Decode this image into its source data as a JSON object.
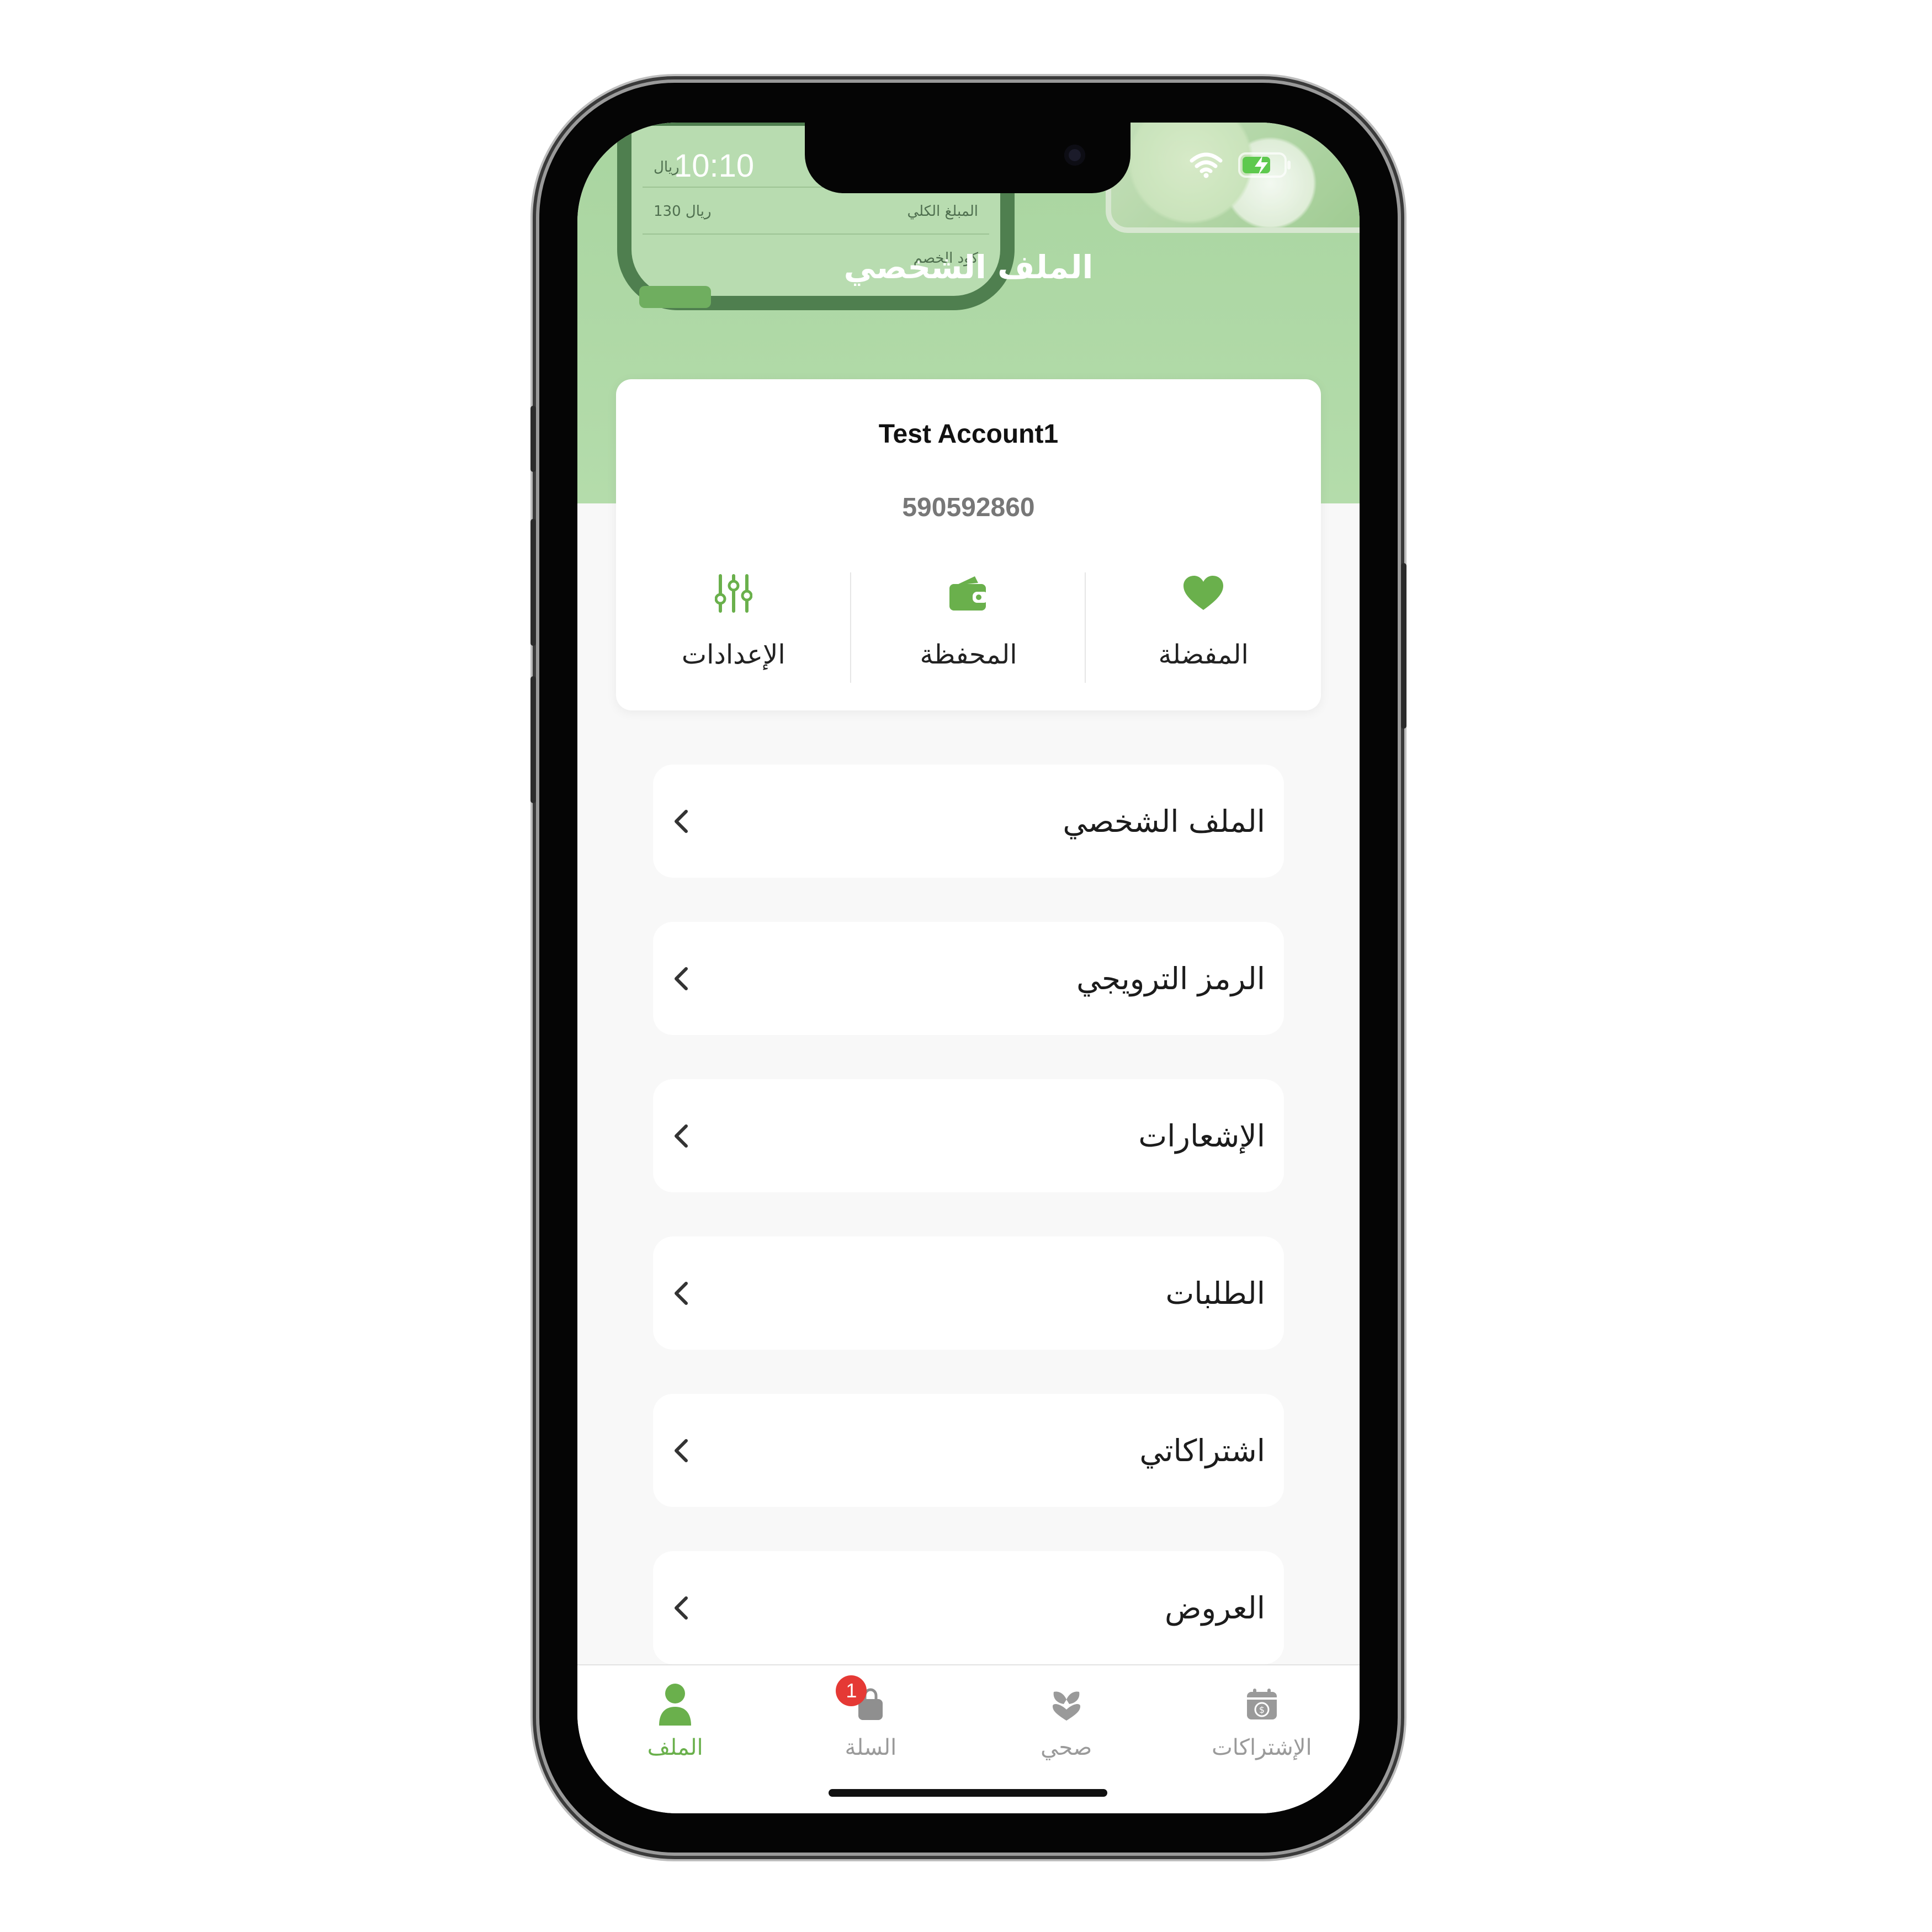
{
  "status_bar": {
    "time": "10:10"
  },
  "background_card": {
    "row1_left": "ريال",
    "row2_left": "130 ريال",
    "row2_right": "المبلغ الكلي",
    "row3_right": "كود الخصم"
  },
  "header": {
    "title": "الملف الشخصي"
  },
  "profile": {
    "name": "Test Account1",
    "phone": "590592860",
    "actions": [
      {
        "label": "المفضلة",
        "icon": "heart-icon"
      },
      {
        "label": "المحفظة",
        "icon": "wallet-icon"
      },
      {
        "label": "الإعدادات",
        "icon": "sliders-icon"
      }
    ]
  },
  "menu": {
    "items": [
      {
        "label": "الملف الشخصي"
      },
      {
        "label": "الرمز الترويجي"
      },
      {
        "label": "الإشعارات"
      },
      {
        "label": "الطلبات"
      },
      {
        "label": "اشتراكاتي"
      },
      {
        "label": "العروض"
      }
    ]
  },
  "tabbar": {
    "tabs": [
      {
        "label": "الملف",
        "icon": "person-icon",
        "active": true
      },
      {
        "label": "السلة",
        "icon": "bag-icon",
        "badge": "1"
      },
      {
        "label": "صحي",
        "icon": "leaf-heart-icon"
      },
      {
        "label": "الإشتراكات",
        "icon": "calendar-dollar-icon"
      }
    ]
  },
  "colors": {
    "accent": "#6ab04c",
    "header_bg": "#b4dcab",
    "badge": "#e53935"
  }
}
